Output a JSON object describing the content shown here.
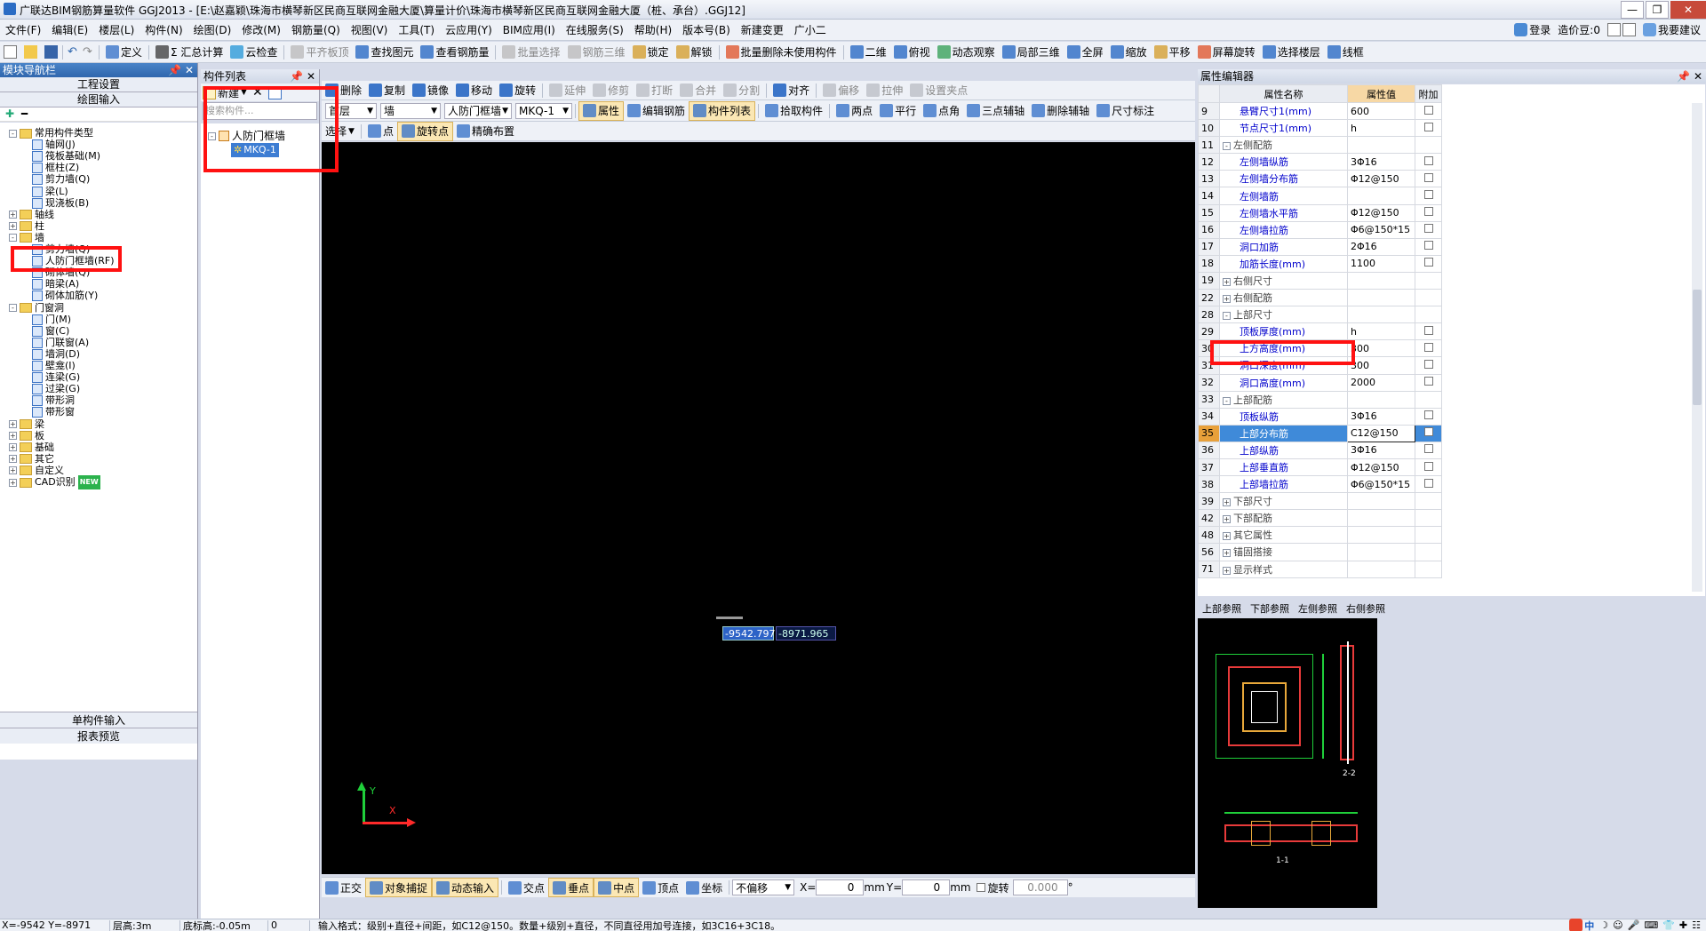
{
  "title_bar": {
    "title": "广联达BIM钢筋算量软件 GGJ2013 - [E:\\赵嘉颖\\珠海市横琴新区民商互联网金融大厦\\算量计价\\珠海市横琴新区民商互联网金融大厦（桩、承台）.GGJ12]",
    "login": "登录",
    "price_bean": "造价豆:0",
    "suggest": "我要建议"
  },
  "menu": [
    "文件(F)",
    "编辑(E)",
    "楼层(L)",
    "构件(N)",
    "绘图(D)",
    "修改(M)",
    "钢筋量(Q)",
    "视图(V)",
    "工具(T)",
    "云应用(Y)",
    "BIM应用(I)",
    "在线服务(S)",
    "帮助(H)",
    "版本号(B)",
    "新建变更",
    "广小二"
  ],
  "toolbar1": [
    "定义",
    "Σ 汇总计算",
    "云检查",
    "平齐板顶",
    "查找图元",
    "查看钢筋量",
    "批量选择",
    "钢筋三维",
    "锁定",
    "解锁",
    "批量删除未使用构件",
    "二维",
    "俯视",
    "动态观察",
    "局部三维",
    "全屏",
    "缩放",
    "平移",
    "屏幕旋转",
    "选择楼层",
    "线框"
  ],
  "nav_panel": {
    "title": "模块导航栏",
    "btn1": "工程设置",
    "btn2": "绘图输入",
    "bottom1": "单构件输入",
    "bottom2": "报表预览",
    "tree": [
      {
        "label": "常用构件类型",
        "level": 1,
        "type": "folder",
        "exp": "-"
      },
      {
        "label": "轴网(J)",
        "level": 2,
        "type": "item"
      },
      {
        "label": "筏板基础(M)",
        "level": 2,
        "type": "item"
      },
      {
        "label": "框柱(Z)",
        "level": 2,
        "type": "item"
      },
      {
        "label": "剪力墙(Q)",
        "level": 2,
        "type": "item"
      },
      {
        "label": "梁(L)",
        "level": 2,
        "type": "item"
      },
      {
        "label": "现浇板(B)",
        "level": 2,
        "type": "item"
      },
      {
        "label": "轴线",
        "level": 1,
        "type": "folder",
        "exp": "+"
      },
      {
        "label": "柱",
        "level": 1,
        "type": "folder",
        "exp": "+"
      },
      {
        "label": "墙",
        "level": 1,
        "type": "folder",
        "exp": "-"
      },
      {
        "label": "剪力墙(Q)",
        "level": 2,
        "type": "item"
      },
      {
        "label": "人防门框墙(RF)",
        "level": 2,
        "type": "item"
      },
      {
        "label": "砌体墙(Q)",
        "level": 2,
        "type": "item"
      },
      {
        "label": "暗梁(A)",
        "level": 2,
        "type": "item"
      },
      {
        "label": "砌体加筋(Y)",
        "level": 2,
        "type": "item"
      },
      {
        "label": "门窗洞",
        "level": 1,
        "type": "folder",
        "exp": "-"
      },
      {
        "label": "门(M)",
        "level": 2,
        "type": "item"
      },
      {
        "label": "窗(C)",
        "level": 2,
        "type": "item"
      },
      {
        "label": "门联窗(A)",
        "level": 2,
        "type": "item"
      },
      {
        "label": "墙洞(D)",
        "level": 2,
        "type": "item"
      },
      {
        "label": "壁龛(I)",
        "level": 2,
        "type": "item"
      },
      {
        "label": "连梁(G)",
        "level": 2,
        "type": "item"
      },
      {
        "label": "过梁(G)",
        "level": 2,
        "type": "item"
      },
      {
        "label": "带形洞",
        "level": 2,
        "type": "item"
      },
      {
        "label": "带形窗",
        "level": 2,
        "type": "item"
      },
      {
        "label": "梁",
        "level": 1,
        "type": "folder",
        "exp": "+"
      },
      {
        "label": "板",
        "level": 1,
        "type": "folder",
        "exp": "+"
      },
      {
        "label": "基础",
        "level": 1,
        "type": "folder",
        "exp": "+"
      },
      {
        "label": "其它",
        "level": 1,
        "type": "folder",
        "exp": "+"
      },
      {
        "label": "自定义",
        "level": 1,
        "type": "folder",
        "exp": "+"
      },
      {
        "label": "CAD识别",
        "level": 1,
        "type": "folder",
        "exp": "+",
        "badge": "NEW"
      }
    ]
  },
  "comp_list": {
    "title": "构件列表",
    "new_btn": "新建",
    "search_placeholder": "搜索构件...",
    "root": "人防门框墙",
    "child": "MKQ-1"
  },
  "draw_toolbar1": [
    "删除",
    "复制",
    "镜像",
    "移动",
    "旋转",
    "延伸",
    "修剪",
    "打断",
    "合并",
    "分割",
    "对齐",
    "偏移",
    "拉伸",
    "设置夹点"
  ],
  "draw_toolbar2": {
    "floor": "首层",
    "category": "墙",
    "type": "人防门框墙",
    "name": "MKQ-1",
    "buttons": [
      "属性",
      "编辑钢筋",
      "构件列表",
      "拾取构件",
      "两点",
      "平行",
      "点角",
      "三点辅轴",
      "删除辅轴",
      "尺寸标注"
    ]
  },
  "draw_toolbar3": [
    "选择",
    "点",
    "旋转点",
    "精确布置"
  ],
  "canvas": {
    "coord_x": "-9542.797",
    "coord_y": "-8971.965",
    "axis_y": "Y",
    "axis_x": "X"
  },
  "bottom_toolbar": {
    "buttons": [
      "正交",
      "对象捕捉",
      "动态输入",
      "交点",
      "垂点",
      "中点",
      "顶点",
      "坐标"
    ],
    "offset": "不偏移",
    "x_label": "X=",
    "x_value": "0",
    "y_label": "Y=",
    "y_value": "0",
    "mm": "mm",
    "rotate": "旋转",
    "rotate_value": "0.000",
    "degree": "°"
  },
  "status_bar": {
    "coords": "X=-9542 Y=-8971",
    "floor_height": "层高:3m",
    "base_height": "底标高:-0.05m",
    "zero": "0",
    "hint": "输入格式：级别+直径+间距，如C12@150。数量+级别+直径，不同直径用加号连接，如3C16+3C18。"
  },
  "props": {
    "title": "属性编辑器",
    "col_name": "属性名称",
    "col_value": "属性值",
    "col_add": "附加",
    "rows": [
      {
        "num": "9",
        "name": "悬臂尺寸1(mm)",
        "value": "600",
        "group": false,
        "chk": true
      },
      {
        "num": "10",
        "name": "节点尺寸1(mm)",
        "value": "h",
        "group": false,
        "chk": true
      },
      {
        "num": "11",
        "name": "左侧配筋",
        "value": "",
        "group": true,
        "exp": "-",
        "chk": false
      },
      {
        "num": "12",
        "name": "左侧墙纵筋",
        "value": "3Φ16",
        "group": false,
        "chk": true
      },
      {
        "num": "13",
        "name": "左侧墙分布筋",
        "value": "Φ12@150",
        "group": false,
        "chk": true
      },
      {
        "num": "14",
        "name": "左侧墙筋",
        "value": "",
        "group": false,
        "chk": true
      },
      {
        "num": "15",
        "name": "左侧墙水平筋",
        "value": "Φ12@150",
        "group": false,
        "chk": true
      },
      {
        "num": "16",
        "name": "左侧墙拉筋",
        "value": "Φ6@150*15",
        "group": false,
        "chk": true
      },
      {
        "num": "17",
        "name": "洞口加筋",
        "value": "2Φ16",
        "group": false,
        "chk": true
      },
      {
        "num": "18",
        "name": "加筋长度(mm)",
        "value": "1100",
        "group": false,
        "chk": true
      },
      {
        "num": "19",
        "name": "右侧尺寸",
        "value": "",
        "group": true,
        "exp": "+",
        "chk": false
      },
      {
        "num": "22",
        "name": "右侧配筋",
        "value": "",
        "group": true,
        "exp": "+",
        "chk": false
      },
      {
        "num": "28",
        "name": "上部尺寸",
        "value": "",
        "group": true,
        "exp": "-",
        "chk": false
      },
      {
        "num": "29",
        "name": "顶板厚度(mm)",
        "value": "h",
        "group": false,
        "chk": true
      },
      {
        "num": "30",
        "name": "上方高度(mm)",
        "value": "300",
        "group": false,
        "chk": true
      },
      {
        "num": "31",
        "name": "洞口深度(mm)",
        "value": "300",
        "group": false,
        "chk": true
      },
      {
        "num": "32",
        "name": "洞口高度(mm)",
        "value": "2000",
        "group": false,
        "chk": true
      },
      {
        "num": "33",
        "name": "上部配筋",
        "value": "",
        "group": true,
        "exp": "-",
        "chk": false
      },
      {
        "num": "34",
        "name": "顶板纵筋",
        "value": "3Φ16",
        "group": false,
        "chk": true
      },
      {
        "num": "35",
        "name": "上部分布筋",
        "value": "C12@150",
        "group": false,
        "chk": true,
        "selected": true
      },
      {
        "num": "36",
        "name": "上部纵筋",
        "value": "3Φ16",
        "group": false,
        "chk": true
      },
      {
        "num": "37",
        "name": "上部垂直筋",
        "value": "Φ12@150",
        "group": false,
        "chk": true
      },
      {
        "num": "38",
        "name": "上部墙拉筋",
        "value": "Φ6@150*15",
        "group": false,
        "chk": true
      },
      {
        "num": "39",
        "name": "下部尺寸",
        "value": "",
        "group": true,
        "exp": "+",
        "chk": false
      },
      {
        "num": "42",
        "name": "下部配筋",
        "value": "",
        "group": true,
        "exp": "+",
        "chk": false
      },
      {
        "num": "48",
        "name": "其它属性",
        "value": "",
        "group": true,
        "exp": "+",
        "chk": false
      },
      {
        "num": "56",
        "name": "锚固搭接",
        "value": "",
        "group": true,
        "exp": "+",
        "chk": false
      },
      {
        "num": "71",
        "name": "显示样式",
        "value": "",
        "group": true,
        "exp": "+",
        "chk": false
      }
    ]
  },
  "ref_tabs": [
    "上部参照",
    "下部参照",
    "左侧参照",
    "右侧参照"
  ],
  "ref_labels": {
    "section2": "2-2",
    "section1": "1-1"
  },
  "colors": {
    "accent": "#2f66ad",
    "highlight": "#ff1111",
    "selected_row": "#3f8ad9"
  }
}
